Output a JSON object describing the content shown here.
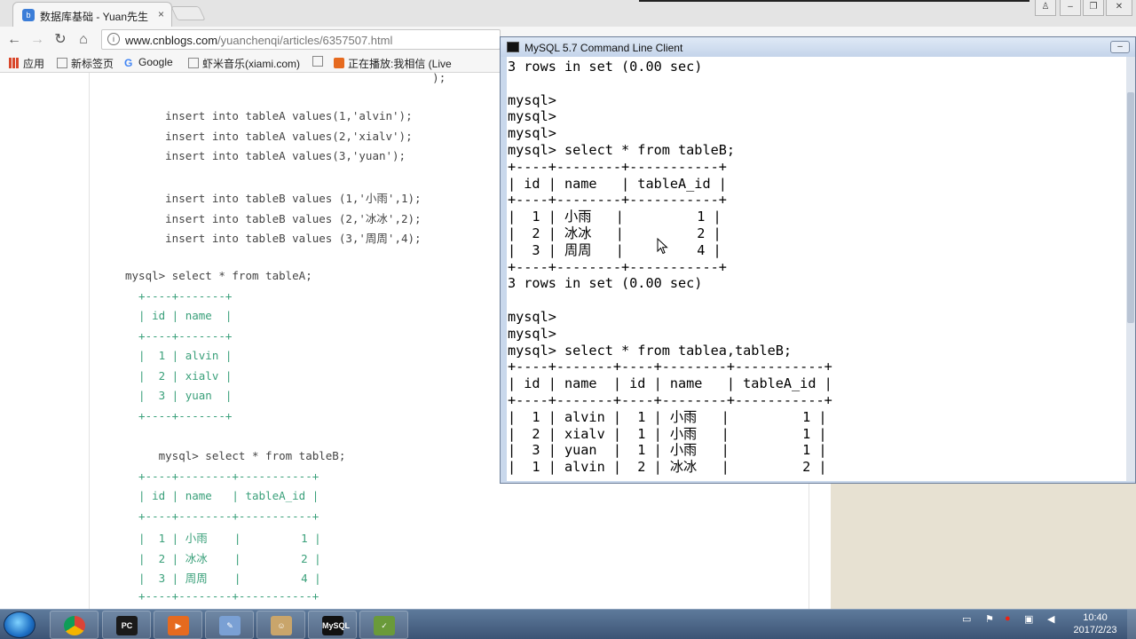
{
  "browser": {
    "tab_title": "数据库基础 - Yuan先生",
    "tab_close": "×",
    "url_host": "www.cnblogs.com",
    "url_path": "/yuanchenqi/articles/6357507.html",
    "nav": {
      "back": "←",
      "forward": "→",
      "reload": "↻",
      "home": "⌂"
    },
    "bookmarks": [
      "应用",
      "新标签页",
      "Google",
      "虾米音乐(xiami.com)",
      "",
      "正在播放:我相信 (Live"
    ]
  },
  "article": {
    "lines": [
      "                                              );",
      "",
      "      insert into tableA values(1,'alvin');",
      "      insert into tableA values(2,'xialv');",
      "      insert into tableA values(3,'yuan');",
      "",
      "      insert into tableB values (1,'小雨',1);",
      "      insert into tableB values (2,'冰冰',2);",
      "      insert into tableB values (3,'周周',4);",
      "",
      "mysql> select * from tableA;",
      "  +----+-------+",
      "  | id | name  |",
      "  +----+-------+",
      "  |  1 | alvin |",
      "  |  2 | xialv |",
      "  |  3 | yuan  |",
      "  +----+-------+",
      "",
      "     mysql> select * from tableB;",
      "  +----+--------+-----------+",
      "  | id | name   | tableA_id |",
      "  +----+--------+-----------+",
      "  |  1 | 小雨    |         1 |",
      "  |  2 | 冰冰    |         2 |",
      "  |  3 | 周周    |         4 |",
      "  +----+--------+-----------+"
    ]
  },
  "console": {
    "title": "MySQL 5.7 Command Line Client",
    "lines": [
      "3 rows in set (0.00 sec)",
      "",
      "mysql>",
      "mysql>",
      "mysql>",
      "mysql> select * from tableB;",
      "+----+--------+-----------+",
      "| id | name   | tableA_id |",
      "+----+--------+-----------+",
      "|  1 | 小雨   |         1 |",
      "|  2 | 冰冰   |         2 |",
      "|  3 | 周周   |         4 |",
      "+----+--------+-----------+",
      "3 rows in set (0.00 sec)",
      "",
      "mysql>",
      "mysql>",
      "mysql> select * from tablea,tableB;",
      "+----+-------+----+--------+-----------+",
      "| id | name  | id | name   | tableA_id |",
      "+----+-------+----+--------+-----------+",
      "|  1 | alvin |  1 | 小雨   |         1 |",
      "|  2 | xialv |  1 | 小雨   |         1 |",
      "|  3 | yuan  |  1 | 小雨   |         1 |",
      "|  1 | alvin |  2 | 冰冰   |         2 |"
    ]
  },
  "taskbar": {
    "apps": [
      {
        "name": "chrome",
        "glyph": "",
        "color": "#d9472b"
      },
      {
        "name": "pycharm",
        "glyph": "PC",
        "color": "#1a1a1a"
      },
      {
        "name": "presenter",
        "glyph": "▶",
        "color": "#e66a1f"
      },
      {
        "name": "paint",
        "glyph": "✎",
        "color": "#7aa0d4"
      },
      {
        "name": "avatar-app",
        "glyph": "☺",
        "color": "#c9a56b"
      },
      {
        "name": "mysql-console",
        "glyph": "MySQL",
        "color": "#111"
      },
      {
        "name": "notepad",
        "glyph": "✓",
        "color": "#6a9a3a"
      }
    ],
    "clock_time": "10:40",
    "clock_date": "2017/2/23"
  }
}
